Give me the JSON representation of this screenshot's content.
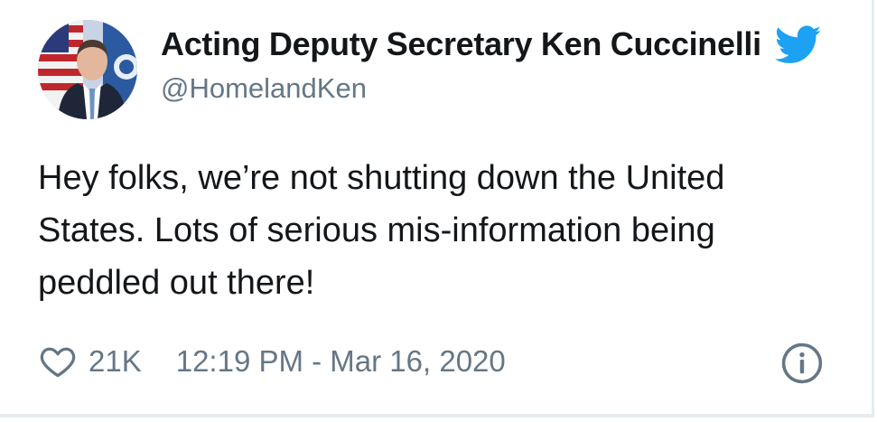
{
  "tweet": {
    "display_name": "Acting Deputy Secretary Ken Cuccinelli",
    "handle": "@HomelandKen",
    "text": "Hey folks, we’re not shutting down the United\nStates.  Lots of serious mis-information being\npeddled out there!",
    "likes": "21K",
    "timestamp": "12:19 PM - Mar 16, 2020"
  },
  "icons": {
    "avatar": "profile-photo",
    "brand": "twitter-bird-icon",
    "like": "heart-icon",
    "info": "info-icon"
  },
  "colors": {
    "text": "#14171a",
    "secondary": "#657786",
    "brand": "#1da1f2"
  }
}
